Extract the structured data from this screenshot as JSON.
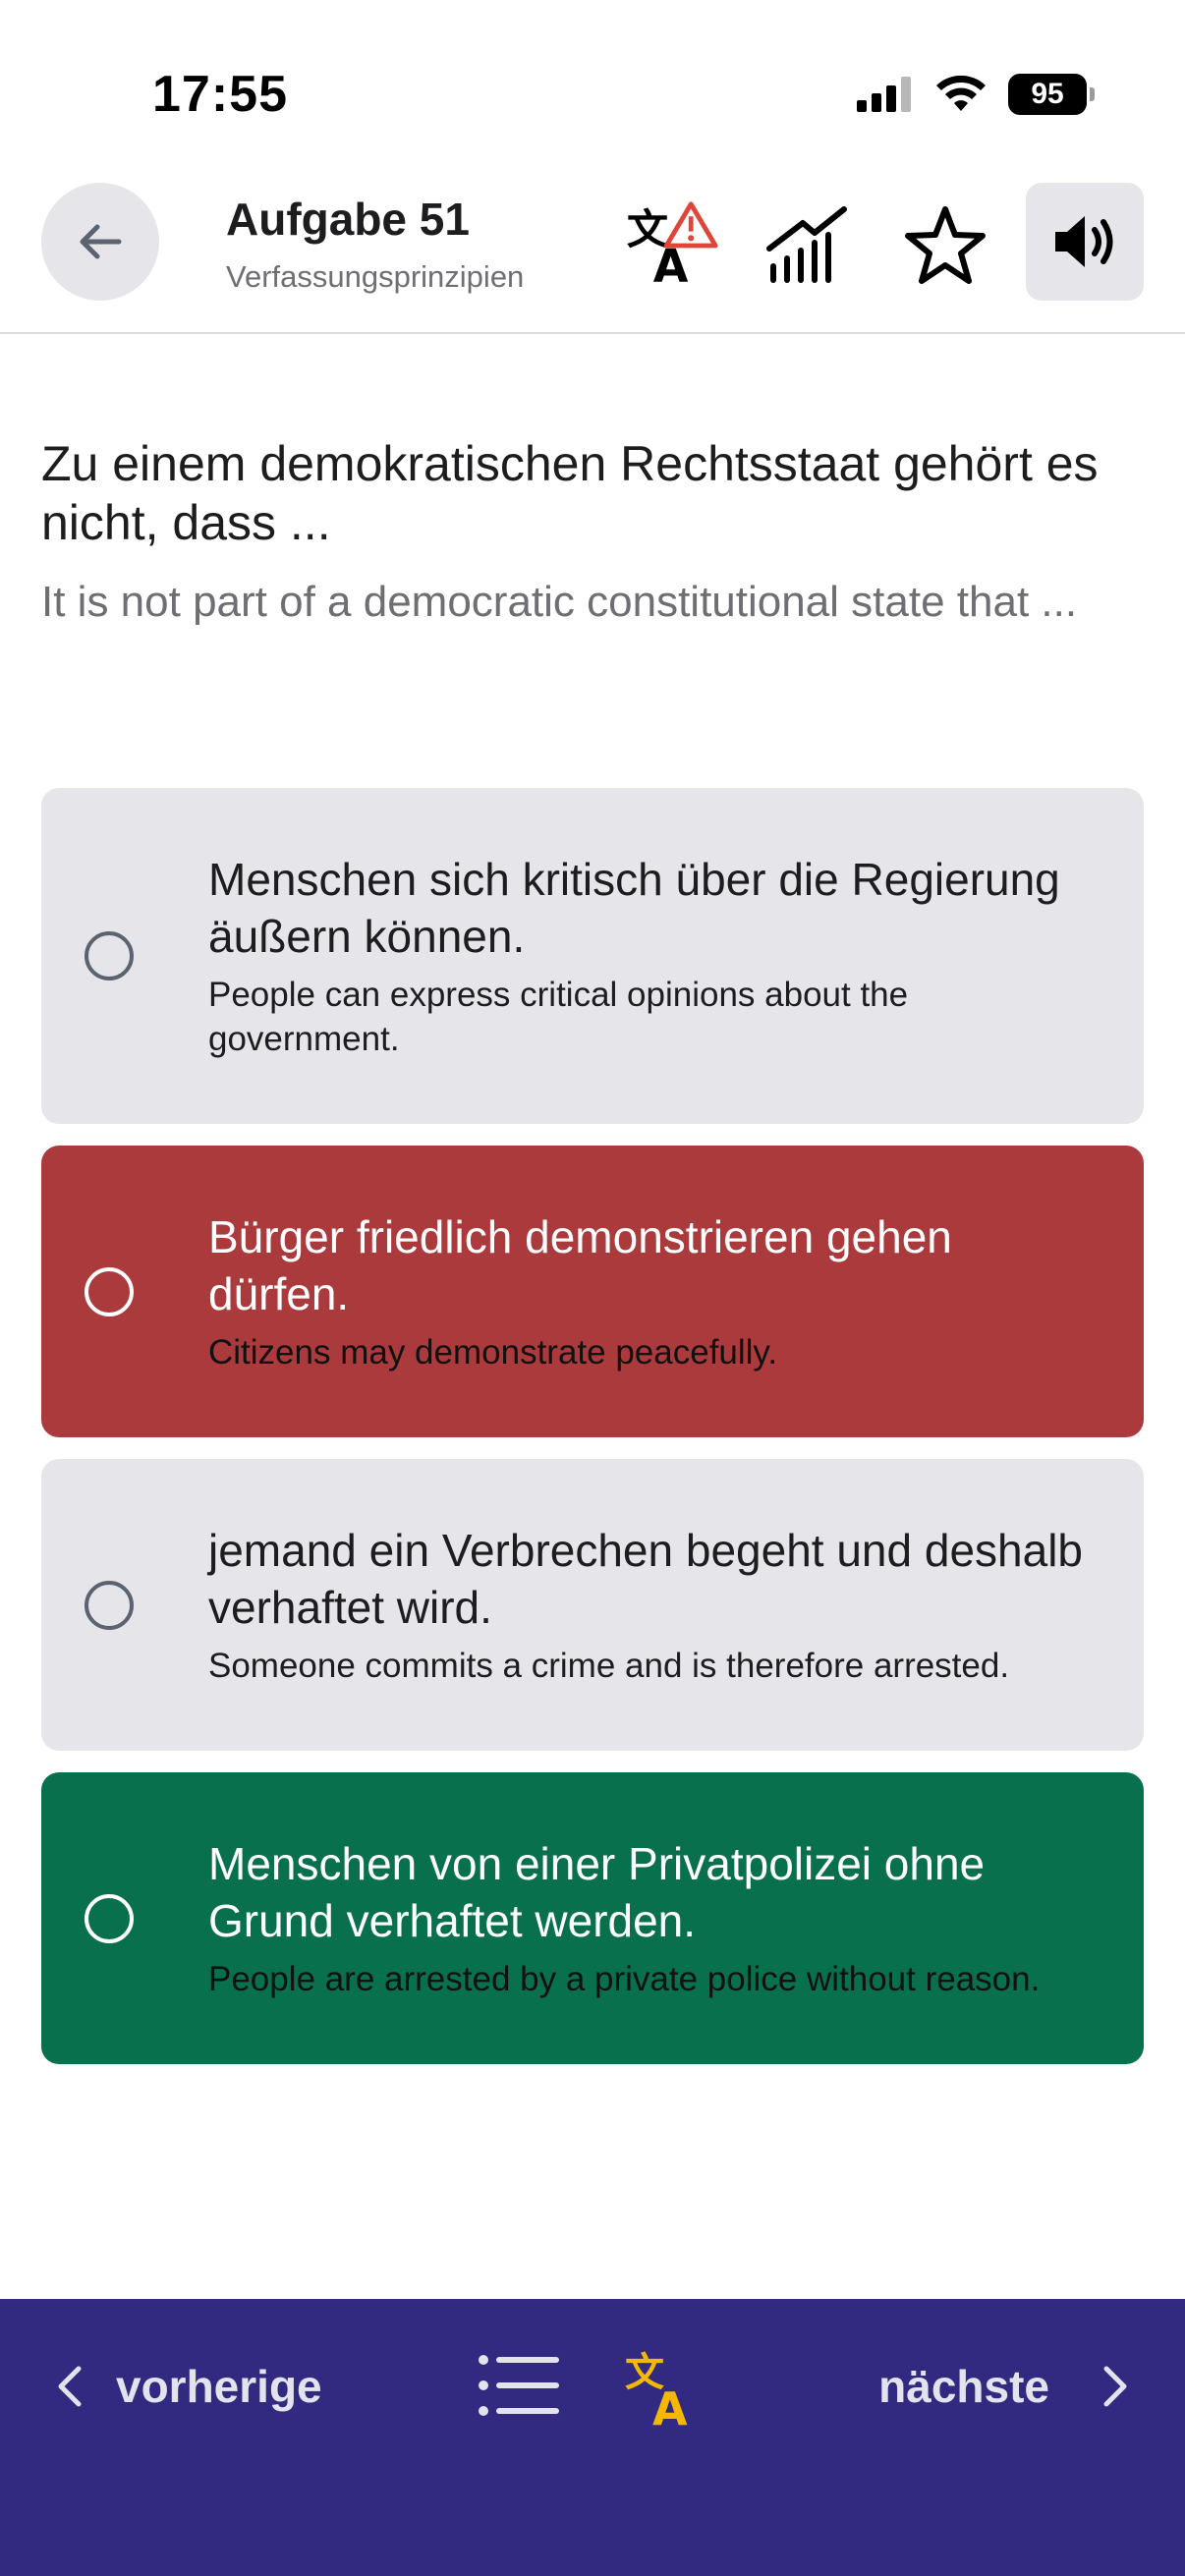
{
  "status_bar": {
    "time": "17:55",
    "battery": "95",
    "icons": [
      "signal-icon",
      "wifi-icon",
      "battery-icon"
    ]
  },
  "header": {
    "title": "Aufgabe 51",
    "subtitle": "Verfassungsprinzipien",
    "icons": [
      "back-arrow-icon",
      "translation-warning-icon",
      "stats-icon",
      "star-icon",
      "speaker-icon"
    ]
  },
  "question": {
    "text_de": "Zu einem demokratischen Rechtsstaat gehört es nicht, dass ...",
    "text_en": "It is not part of a democratic constitutional state that ..."
  },
  "answers": [
    {
      "text_de": "Menschen sich kritisch über die Regierung äußern können.",
      "text_en": "People can express critical opinions about the government.",
      "state": "neutral"
    },
    {
      "text_de": "Bürger friedlich demonstrieren gehen dürfen.",
      "text_en": "Citizens may demonstrate peacefully.",
      "state": "wrong"
    },
    {
      "text_de": "jemand ein Verbrechen begeht und deshalb verhaftet wird.",
      "text_en": "Someone commits a crime and is therefore arrested.",
      "state": "neutral"
    },
    {
      "text_de": "Menschen von einer Privatpolizei ohne Grund verhaftet werden.",
      "text_en": "People are arrested by a private police without reason.",
      "state": "correct"
    }
  ],
  "bottom_nav": {
    "prev_label": "vorherige",
    "next_label": "nächste",
    "icons": [
      "chevron-left-icon",
      "list-icon",
      "translate-icon",
      "chevron-right-icon"
    ]
  },
  "colors": {
    "wrong": "#aa3a3c",
    "correct": "#08704d",
    "neutral": "#e6e6ea",
    "bottom_bar": "#312a80",
    "accent_yellow": "#f5b800",
    "warning_red": "#e0453a"
  }
}
